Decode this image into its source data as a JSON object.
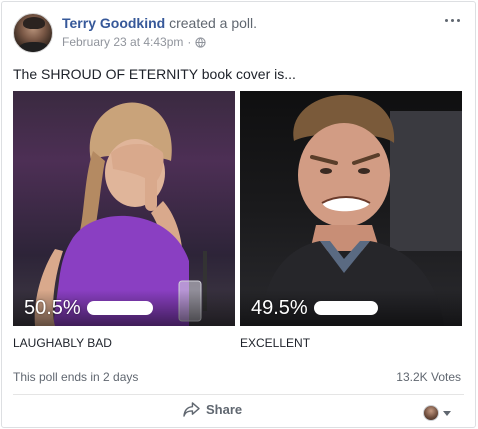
{
  "post": {
    "author": "Terry Goodkind",
    "action": "created a poll.",
    "timestamp": "February 23 at 4:43pm",
    "separator": "·",
    "privacy_icon": "globe-icon",
    "more_icon": "more-options-icon"
  },
  "poll": {
    "question": "The SHROUD OF ETERNITY book cover is...",
    "options": [
      {
        "label": "LAUGHABLY BAD",
        "percent_text": "50.5%",
        "percent": 50.5,
        "image": "woman-facepalm-photo"
      },
      {
        "label": "EXCELLENT",
        "percent_text": "49.5%",
        "percent": 49.5,
        "image": "man-grimacing-photo"
      }
    ],
    "ends_text": "This poll ends in 2 days",
    "votes_text": "13.2K Votes"
  },
  "actions": {
    "share_label": "Share",
    "share_icon": "share-arrow-icon",
    "audience_icon": "audience-avatar"
  },
  "colors": {
    "author_link": "#365899",
    "secondary_text": "#606770",
    "meta_text": "#90949c",
    "bar": "#ffffff"
  }
}
